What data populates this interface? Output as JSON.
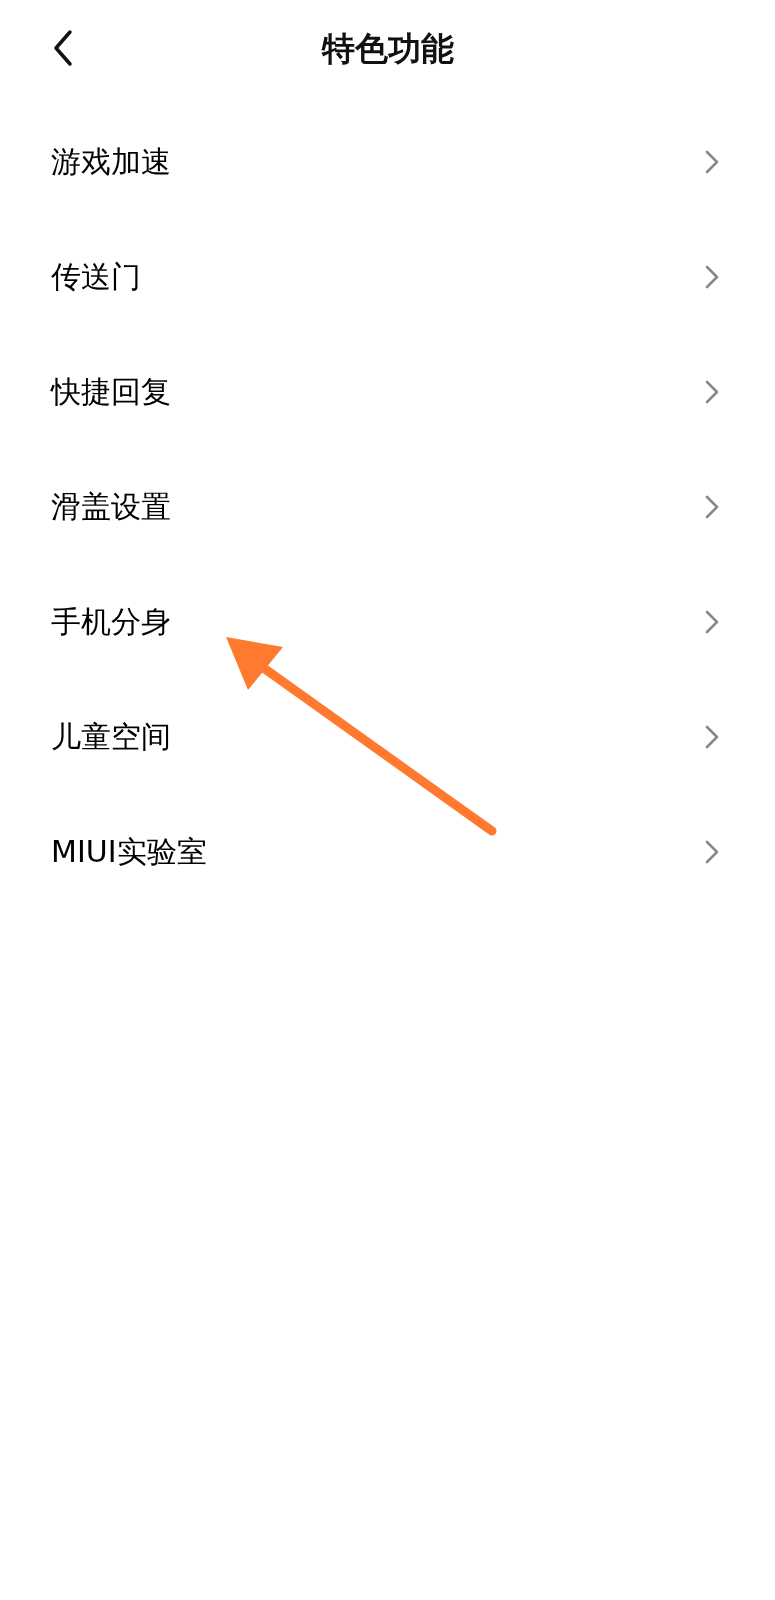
{
  "header": {
    "title": "特色功能"
  },
  "items": [
    {
      "label": "游戏加速"
    },
    {
      "label": "传送门"
    },
    {
      "label": "快捷回复"
    },
    {
      "label": "滑盖设置"
    },
    {
      "label": "手机分身"
    },
    {
      "label": "儿童空间"
    },
    {
      "label": "MIUI实验室"
    }
  ]
}
